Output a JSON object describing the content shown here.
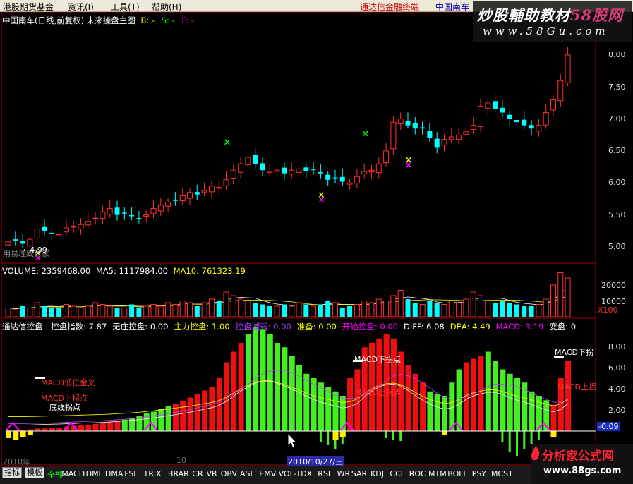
{
  "menubar": {
    "items": [
      "港股期货基金",
      "资讯(I)",
      "工具(T)",
      "帮助(H)"
    ],
    "right_red": "通达信金融终端",
    "right_blue": "中国南车"
  },
  "watermark": {
    "title_a": "炒股輔助教材",
    "title_b": "58股网",
    "url": "www.58Gu.com"
  },
  "main": {
    "title": "中国南车(日线,前复权) 未来操盘主图",
    "legend_b": "B: -",
    "legend_s": "S: -",
    "legend_f": "F: -",
    "y_ticks": [
      "8.00",
      "7.50",
      "7.00",
      "6.50",
      "6.00",
      "5.50",
      "5.00"
    ],
    "low_marker": "4.99",
    "watermark_left": "用易理致财家",
    "colors": {
      "up": "#ff3030",
      "down": "#00ffff",
      "buy": "#ff00ff",
      "sell": "#00ff00"
    }
  },
  "volume": {
    "title_label": "VOLUME: 2359468.00",
    "ma5": "MA5: 1117984.00",
    "ma10": "MA10: 761323.19",
    "y_ticks": [
      "20000",
      "10000"
    ],
    "unit": "X100"
  },
  "indicator": {
    "name": "通达信控盘",
    "items": [
      {
        "label": "控盘指数: 7.87",
        "color": "#ffffff"
      },
      {
        "label": "无庄控盘: 0.00",
        "color": "#ffffff"
      },
      {
        "label": "主力控盘: 1.00",
        "color": "#ffff00"
      },
      {
        "label": "控盘减弱: 0.00",
        "color": "#b040ff"
      },
      {
        "label": "准备: 0.00",
        "color": "#ffff00"
      },
      {
        "label": "开始控盘: 0.00",
        "color": "#ff00ff"
      },
      {
        "label": "DIFF: 6.08",
        "color": "#ffffff"
      },
      {
        "label": "DEA: 4.49",
        "color": "#ffff00"
      },
      {
        "label": "MACD: 3.19",
        "color": "#ff00ff"
      },
      {
        "label": "变盘: 0",
        "color": "#ffffff"
      }
    ],
    "y_ticks": [
      "8.00",
      "6.00",
      "4.00",
      "2.00"
    ],
    "current_value": "-0.09",
    "annotations": {
      "macd_golden": "MACD低位金叉",
      "macd_up": "MACD上拐点",
      "bottom_turn": "底线拐点",
      "macd_down_mid": "MACD下拐点",
      "macd_up_mid": "MACD上拐点",
      "macd_down_right": "MACD下拐",
      "macd_up_right": "MACD上拐"
    }
  },
  "axis": {
    "year": "2010年",
    "month": "10",
    "cursor_date": "2010/10/27/三"
  },
  "tabs": [
    "指标",
    "模板",
    "全部",
    "MACD",
    "DMI",
    "DMA",
    "FSL",
    "TRIX",
    "BRAR",
    "CR",
    "VR",
    "OBV",
    "ASI",
    "EMV",
    "VOL-TDX",
    "RSI",
    "WR",
    "SAR",
    "KDJ",
    "CCI",
    "ROC",
    "MTM",
    "BOLL",
    "PSY",
    "MCST"
  ],
  "logo": {
    "text": "分析家公式网",
    "url": "www.88gs.com"
  }
}
